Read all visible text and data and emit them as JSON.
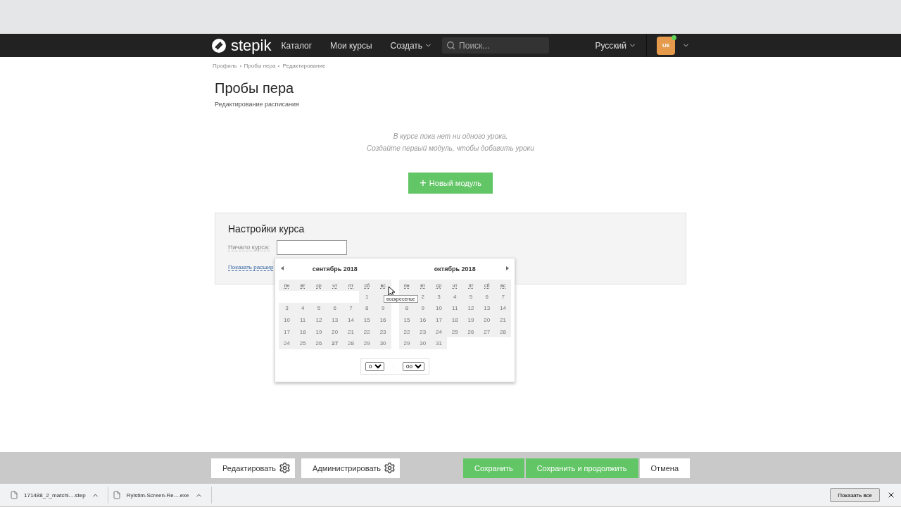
{
  "navbar": {
    "logo": "stepik",
    "links": [
      {
        "label": "Каталог",
        "dropdown": false
      },
      {
        "label": "Мои курсы",
        "dropdown": false
      },
      {
        "label": "Создать",
        "dropdown": true
      }
    ],
    "search": {
      "placeholder": "Поиск..."
    },
    "language": "Русский",
    "avatar": {
      "initials": "U6",
      "online": true
    }
  },
  "breadcrumbs": [
    "Профиль",
    "Пробы пера",
    "Редактирование"
  ],
  "title": "Пробы пера",
  "subtitle": "Редактирование расписания",
  "empty_message": [
    "В курсе пока нет ни одного урока.",
    "Создайте первый модуль, чтобы добавить уроки"
  ],
  "new_module_button": {
    "icon": "+",
    "label": "Новый модуль"
  },
  "settings": {
    "title": "Настройки курса",
    "start_label": "Начало курса:",
    "advanced_link": "Показать расшир",
    "calendar": {
      "tooltip": "воскресенье",
      "months": [
        {
          "title": "сентябрь 2018",
          "weekdays": [
            "пн",
            "вт",
            "ср",
            "чт",
            "пт",
            "сб",
            "вс"
          ],
          "weeks": [
            [
              {
                "kind": "blank"
              },
              {
                "kind": "blank"
              },
              {
                "kind": "blank"
              },
              {
                "kind": "blank"
              },
              {
                "kind": "blank"
              },
              {
                "kind": "day",
                "t": "1"
              },
              {
                "kind": "covered"
              }
            ],
            [
              {
                "kind": "day",
                "t": "3"
              },
              {
                "kind": "day",
                "t": "4"
              },
              {
                "kind": "day",
                "t": "5"
              },
              {
                "kind": "day",
                "t": "6"
              },
              {
                "kind": "day",
                "t": "7"
              },
              {
                "kind": "day",
                "t": "8"
              },
              {
                "kind": "day",
                "t": "9"
              }
            ],
            [
              {
                "kind": "day",
                "t": "10"
              },
              {
                "kind": "day",
                "t": "11"
              },
              {
                "kind": "day",
                "t": "12"
              },
              {
                "kind": "day",
                "t": "13"
              },
              {
                "kind": "day",
                "t": "14"
              },
              {
                "kind": "day",
                "t": "15"
              },
              {
                "kind": "day",
                "t": "16"
              }
            ],
            [
              {
                "kind": "day",
                "t": "17"
              },
              {
                "kind": "day",
                "t": "18"
              },
              {
                "kind": "day",
                "t": "19"
              },
              {
                "kind": "day",
                "t": "20"
              },
              {
                "kind": "day",
                "t": "21"
              },
              {
                "kind": "day",
                "t": "22"
              },
              {
                "kind": "day",
                "t": "23"
              }
            ],
            [
              {
                "kind": "day",
                "t": "24"
              },
              {
                "kind": "day",
                "t": "25"
              },
              {
                "kind": "day",
                "t": "26"
              },
              {
                "kind": "today",
                "t": "27"
              },
              {
                "kind": "day",
                "t": "28"
              },
              {
                "kind": "day",
                "t": "29"
              },
              {
                "kind": "day",
                "t": "30"
              }
            ]
          ]
        },
        {
          "title": "октябрь 2018",
          "weekdays": [
            "пн",
            "вт",
            "ср",
            "чт",
            "пт",
            "сб",
            "вс"
          ],
          "weeks": [
            [
              {
                "kind": "covered"
              },
              {
                "kind": "day",
                "t": "2"
              },
              {
                "kind": "day",
                "t": "3"
              },
              {
                "kind": "day",
                "t": "4"
              },
              {
                "kind": "day",
                "t": "5"
              },
              {
                "kind": "day",
                "t": "6"
              },
              {
                "kind": "day",
                "t": "7"
              }
            ],
            [
              {
                "kind": "day",
                "t": "8"
              },
              {
                "kind": "day",
                "t": "9"
              },
              {
                "kind": "day",
                "t": "10"
              },
              {
                "kind": "day",
                "t": "11"
              },
              {
                "kind": "day",
                "t": "12"
              },
              {
                "kind": "day",
                "t": "13"
              },
              {
                "kind": "day",
                "t": "14"
              }
            ],
            [
              {
                "kind": "day",
                "t": "15"
              },
              {
                "kind": "day",
                "t": "16"
              },
              {
                "kind": "day",
                "t": "17"
              },
              {
                "kind": "day",
                "t": "18"
              },
              {
                "kind": "day",
                "t": "19"
              },
              {
                "kind": "day",
                "t": "20"
              },
              {
                "kind": "day",
                "t": "21"
              }
            ],
            [
              {
                "kind": "day",
                "t": "22"
              },
              {
                "kind": "day",
                "t": "23"
              },
              {
                "kind": "day",
                "t": "24"
              },
              {
                "kind": "day",
                "t": "25"
              },
              {
                "kind": "day",
                "t": "26"
              },
              {
                "kind": "day",
                "t": "27"
              },
              {
                "kind": "day",
                "t": "28"
              }
            ],
            [
              {
                "kind": "day",
                "t": "29"
              },
              {
                "kind": "day",
                "t": "30"
              },
              {
                "kind": "day",
                "t": "31"
              },
              {
                "kind": "blank"
              },
              {
                "kind": "blank"
              },
              {
                "kind": "blank"
              },
              {
                "kind": "blank"
              }
            ]
          ]
        }
      ],
      "time": {
        "hour": "0",
        "separator": ":",
        "minute": "00"
      }
    }
  },
  "footer": {
    "left_buttons": [
      {
        "label": "Редактировать"
      },
      {
        "label": "Администрировать"
      }
    ],
    "right_buttons": [
      {
        "label": "Сохранить",
        "kind": "primary"
      },
      {
        "label": "Сохранить и продолжить",
        "kind": "primary"
      },
      {
        "label": "Отмена",
        "kind": "secondary"
      }
    ]
  },
  "downloads": {
    "items": [
      "171488_2_matchi....step",
      "Rylstim-Screen-Re....exe"
    ],
    "show_all": "Показать все"
  }
}
